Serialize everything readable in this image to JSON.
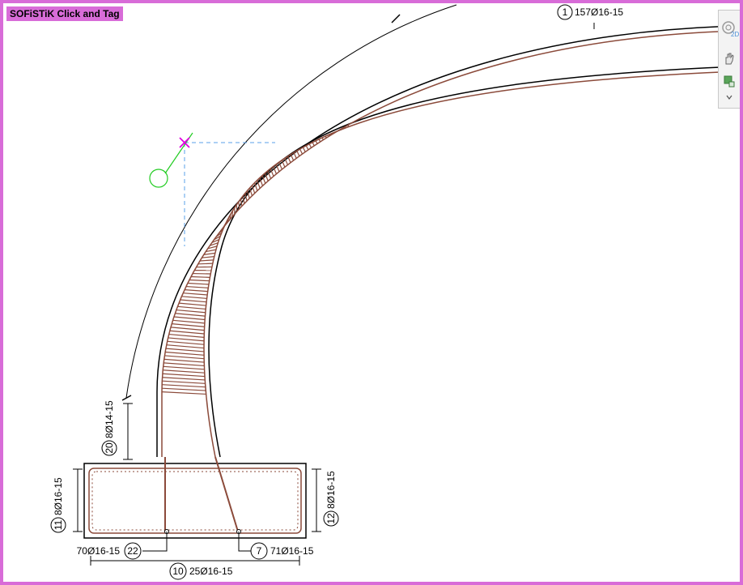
{
  "app": {
    "title": "SOFiSTiK Click and Tag"
  },
  "nav_bar": {
    "buttons": [
      {
        "icon": "steering-wheel-2d-icon",
        "badge": "2D"
      },
      {
        "icon": "pan-hand-icon"
      },
      {
        "icon": "zoom-icon"
      },
      {
        "icon": "chevron-down-icon"
      }
    ]
  },
  "tags": [
    {
      "number": "1",
      "text": "157Ø16-15"
    },
    {
      "number": "20",
      "text": "8Ø14-15"
    },
    {
      "number": "11",
      "text": "8Ø16-15"
    },
    {
      "number": "12",
      "text": "8Ø16-15"
    },
    {
      "number": "22",
      "text": "70Ø16-15"
    },
    {
      "number": "7",
      "text": "71Ø16-15"
    },
    {
      "number": "10",
      "text": "25Ø16-15"
    }
  ],
  "colors": {
    "frame": "#d86cd8",
    "rebar": "#8b4a3a",
    "cursor": "#e000e0",
    "guide": "#5aa0e8",
    "pointer_circle": "#22cc22"
  }
}
